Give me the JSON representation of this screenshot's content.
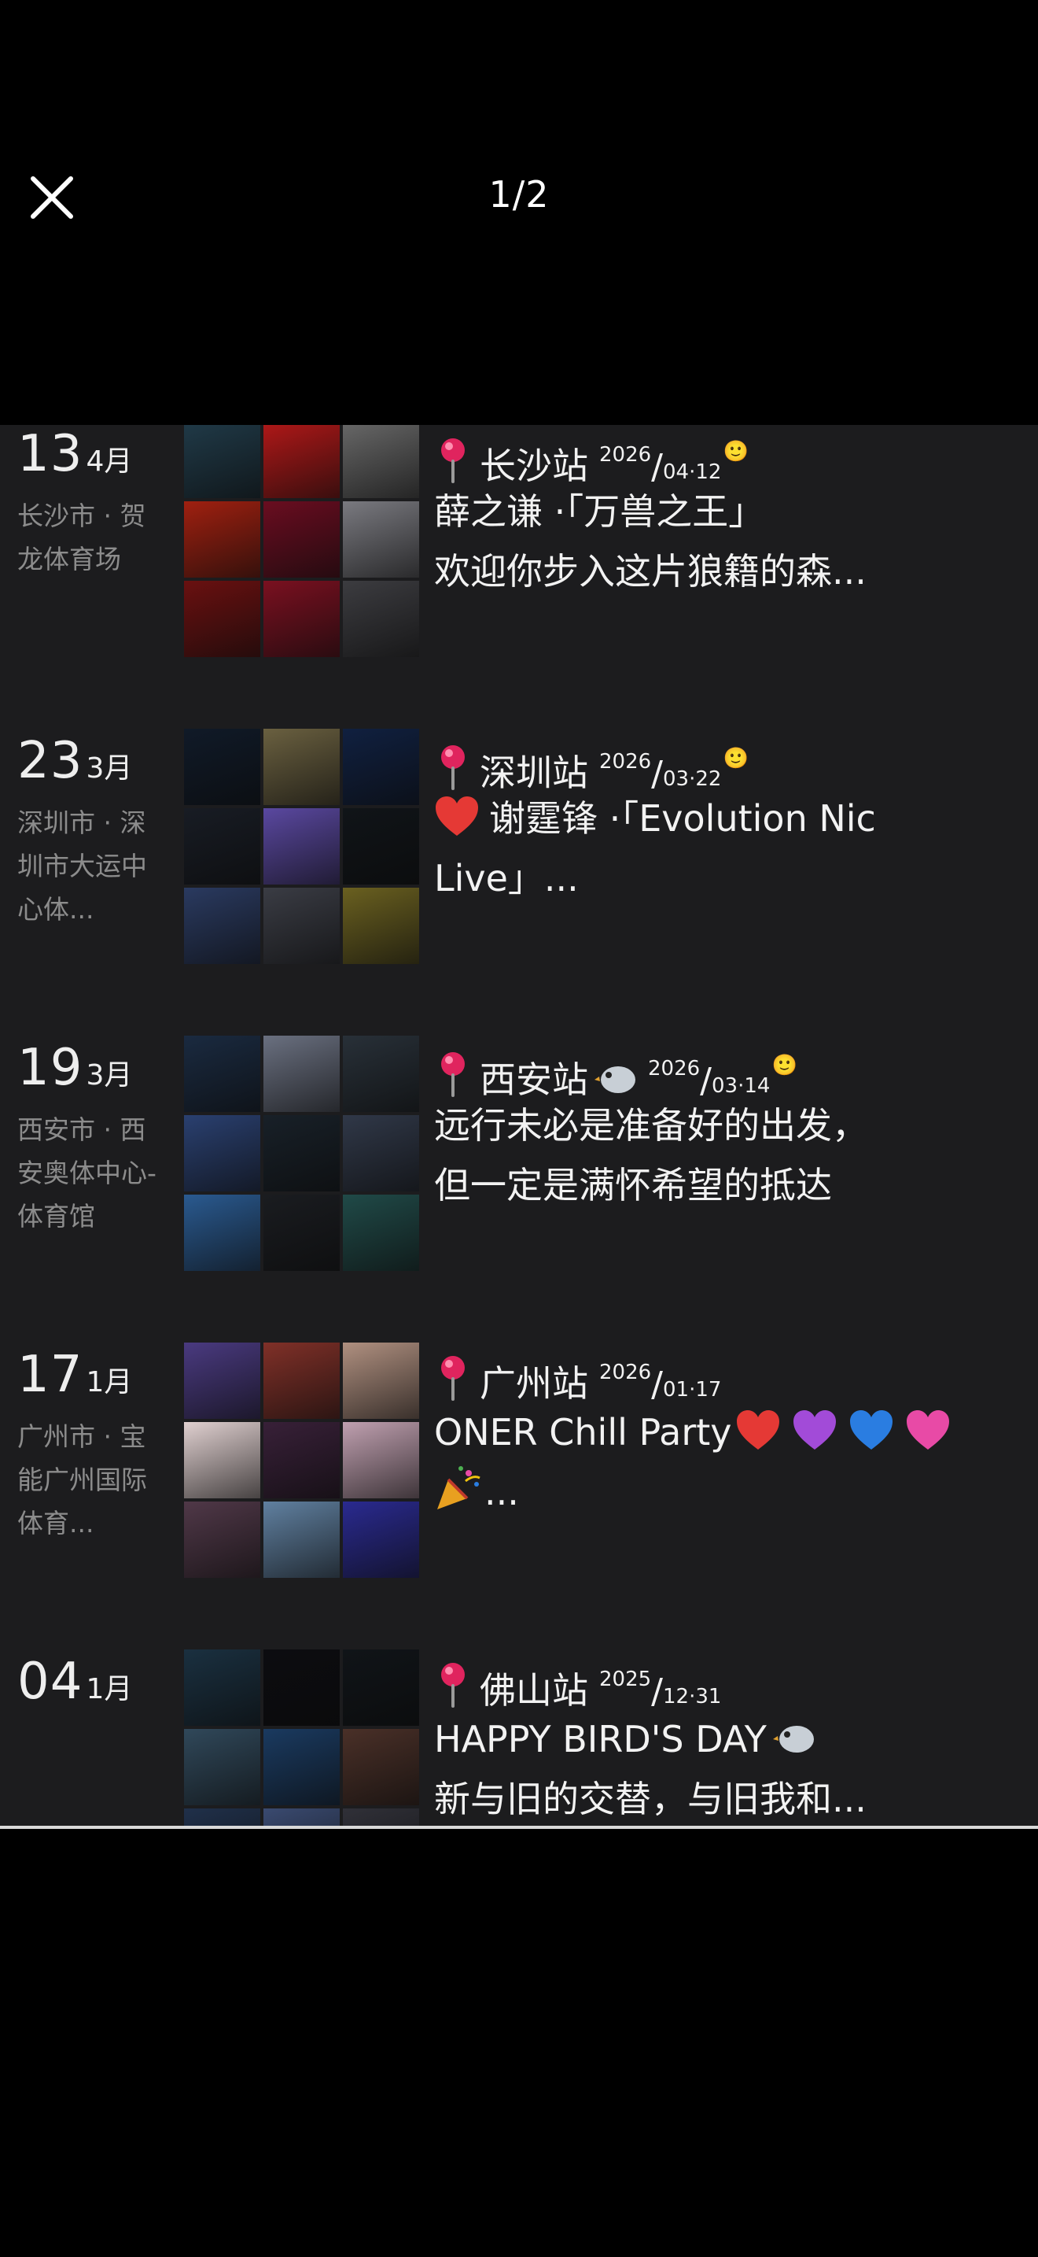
{
  "viewer": {
    "counter": "1/2",
    "close_icon": "close-icon"
  },
  "colors": {
    "background": "#000000",
    "panel": "#1c1c1e",
    "text": "#f2f2f2",
    "muted": "#8c8c8c",
    "pin": "#e0245e",
    "heart_red": "#e53935",
    "heart_purple": "#a24bd8",
    "heart_blue": "#2a7de1",
    "heart_pink": "#e84aa6"
  },
  "entries": [
    {
      "day": "13",
      "month": "4月",
      "location": "长沙市 · 贺龙体育场",
      "station": "长沙站",
      "year": "2026",
      "md": "04·12",
      "has_smile": true,
      "desc_lines": [
        "薛之谦 ·「万兽之王」",
        "欢迎你步入这片狼籍的森..."
      ],
      "thumbs": [
        "#203a48",
        "#b01818",
        "#686868",
        "#a02010",
        "#6a0d20",
        "#7a7a80",
        "#6a1010",
        "#7a1020",
        "#3c3c40"
      ]
    },
    {
      "day": "23",
      "month": "3月",
      "location": "深圳市 · 深圳市大运中心体...",
      "station": "深圳站",
      "year": "2026",
      "md": "03·22",
      "has_smile": true,
      "desc_lines": [
        "谢霆锋 ·「Evolution Nic",
        "Live」..."
      ],
      "thumbs": [
        "#101a28",
        "#6a6040",
        "#102040",
        "#181c24",
        "#5a48a0",
        "#101418",
        "#2a3a60",
        "#3a3c44",
        "#6a6020"
      ]
    },
    {
      "day": "19",
      "month": "3月",
      "location": "西安市 · 西安奥体中心-体育馆",
      "station": "西安站",
      "year": "2026",
      "md": "03·14",
      "has_smile": true,
      "desc_lines": [
        "远行未必是准备好的出发，",
        "但一定是满怀希望的抵达"
      ],
      "thumbs": [
        "#1a2a40",
        "#6a7080",
        "#283038",
        "#2a4070",
        "#182028",
        "#303848",
        "#2a5a90",
        "#1a1c20",
        "#204a48"
      ]
    },
    {
      "day": "17",
      "month": "1月",
      "location": "广州市 · 宝能广州国际体育...",
      "station": "广州站",
      "year": "2026",
      "md": "01·17",
      "has_smile": false,
      "desc_lines": [
        "ONER Chill Party",
        "..."
      ],
      "thumbs": [
        "#4a3a80",
        "#803028",
        "#b09080",
        "#e0d0d0",
        "#382038",
        "#c0a0b0",
        "#503848",
        "#6080a0",
        "#2a2a90"
      ]
    },
    {
      "day": "04",
      "month": "1月",
      "location": "",
      "station": "佛山站",
      "year": "2025",
      "md": "12·31",
      "has_smile": false,
      "desc_lines": [
        "HAPPY BIRD'S DAY",
        "新与旧的交替，与旧我和..."
      ],
      "thumbs": [
        "#1a3040",
        "#0c0c10",
        "#101418",
        "#30485a",
        "#1a3a60",
        "#4a3028",
        "#20304a",
        "#3a4a70",
        "#303038"
      ]
    }
  ]
}
